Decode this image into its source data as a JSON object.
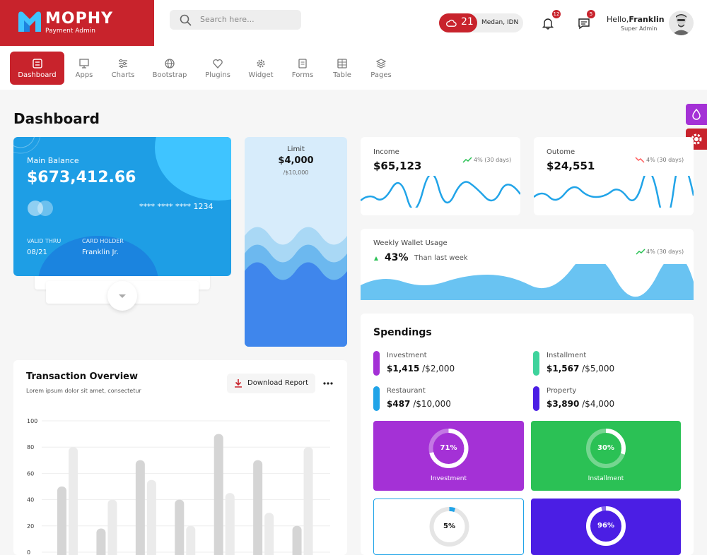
{
  "brand": {
    "name": "MOPHY",
    "sub": "Payment Admin"
  },
  "search": {
    "placeholder": "Search here..."
  },
  "weather": {
    "temp": "21",
    "location": "Medan, IDN"
  },
  "notifications": {
    "bell_count": "12",
    "chat_count": "5"
  },
  "user": {
    "hello": "Hello,",
    "name": "Franklin",
    "role": "Super Admin"
  },
  "nav": [
    {
      "label": "Dashboard",
      "icon": "dashboard-icon"
    },
    {
      "label": "Apps",
      "icon": "monitor-icon"
    },
    {
      "label": "Charts",
      "icon": "sliders-icon"
    },
    {
      "label": "Bootstrap",
      "icon": "globe-icon"
    },
    {
      "label": "Plugins",
      "icon": "heart-icon"
    },
    {
      "label": "Widget",
      "icon": "gear-icon"
    },
    {
      "label": "Forms",
      "icon": "forms-icon"
    },
    {
      "label": "Table",
      "icon": "table-icon"
    },
    {
      "label": "Pages",
      "icon": "layers-icon"
    }
  ],
  "page": {
    "title": "Dashboard"
  },
  "balance": {
    "label": "Main Balance",
    "amount": "$673,412.66",
    "card_number": "**** **** **** 1234",
    "valid_label": "VALID THRU",
    "valid": "08/21",
    "holder_label": "CARD HOLDER",
    "holder": "Franklin Jr."
  },
  "limit": {
    "label": "Limit",
    "amount": "$4,000",
    "max": "/$10,000"
  },
  "income": {
    "label": "Income",
    "amount": "$65,123",
    "trend": "4% (30 days)",
    "trend_color": "#2bc155"
  },
  "outcome": {
    "label": "Outome",
    "amount": "$24,551",
    "trend": "4% (30 days)",
    "trend_color": "#ff5e5e"
  },
  "wallet": {
    "label": "Weekly Wallet Usage",
    "pct": "43%",
    "compare": "Than last week",
    "trend": "4% (30 days)"
  },
  "spendings": {
    "title": "Spendings",
    "items": [
      {
        "label": "Investment",
        "spent": "$1,415",
        "total": "/$2,000",
        "color": "#a431d6"
      },
      {
        "label": "Installment",
        "spent": "$1,567",
        "total": "/$5,000",
        "color": "#3ed39c"
      },
      {
        "label": "Restaurant",
        "spent": "$487",
        "total": "/$10,000",
        "color": "#21a4e8"
      },
      {
        "label": "Property",
        "spent": "$3,890",
        "total": "/$4,000",
        "color": "#4b1ee4"
      }
    ],
    "boxes": [
      {
        "pct": "71%",
        "name": "Investment",
        "value": 71,
        "bg": "#a431d6"
      },
      {
        "pct": "30%",
        "name": "Installment",
        "value": 30,
        "bg": "#2bc155"
      },
      {
        "pct": "5%",
        "name": "",
        "value": 5,
        "bg": "#ffffff"
      },
      {
        "pct": "96%",
        "name": "",
        "value": 96,
        "bg": "#4b1ee4"
      }
    ]
  },
  "transaction": {
    "title": "Transaction Overview",
    "sub": "Lorem ipsum dolor sit amet, consectetur",
    "download": "Download Report"
  },
  "chart_data": {
    "type": "bar",
    "ylim": [
      0,
      100
    ],
    "yticks": [
      100,
      80,
      60,
      40,
      20,
      0
    ],
    "series": [
      {
        "values": [
          50,
          18,
          70,
          40,
          90,
          70,
          20
        ],
        "color": "#d5d5d5"
      },
      {
        "values": [
          80,
          40,
          55,
          20,
          45,
          30,
          80
        ],
        "color": "#ebebeb"
      }
    ]
  }
}
